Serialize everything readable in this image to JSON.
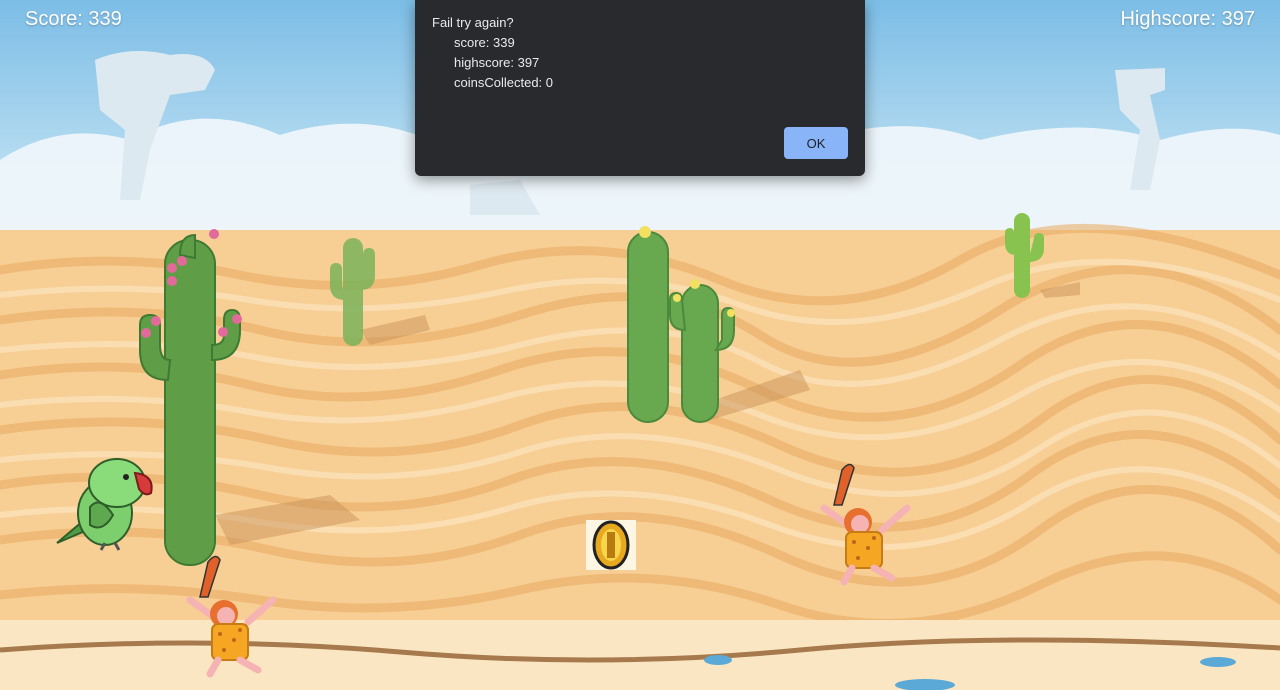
{
  "hud": {
    "score_label": "Score: 339",
    "highscore_label": "Highscore: 397"
  },
  "dialog": {
    "title": "Fail try again?",
    "lines": [
      "score: 339",
      "highscore: 397",
      "coinsCollected: 0"
    ],
    "ok_label": "OK",
    "ok_color": "#8ab4f8"
  },
  "colors": {
    "sky": "#7fbfe6",
    "sand": "#f7cf95",
    "cactus": "#6fae55",
    "dialog_bg": "#292a2d"
  },
  "sprites": {
    "player": "parrot-icon",
    "enemies": [
      "caveman-icon",
      "caveman-icon"
    ],
    "pickup": "coin-icon"
  }
}
